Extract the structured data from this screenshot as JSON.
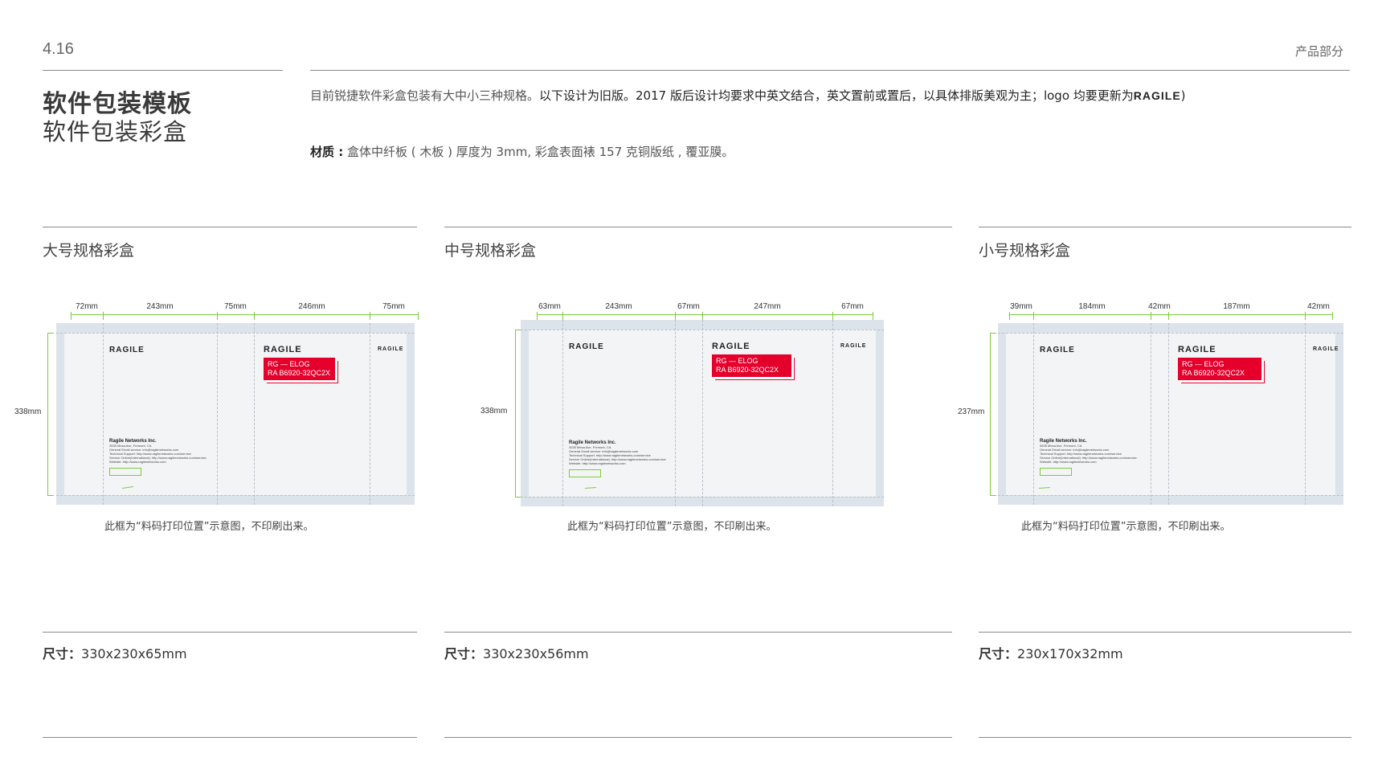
{
  "header": {
    "page_number": "4.16",
    "section": "产品部分",
    "title_main": "软件包装模板",
    "title_sub": "软件包装彩盒"
  },
  "intro": {
    "part1": "目前锐捷软件彩盒包装有大中小三种规格。",
    "part2": "以下设计为旧版。2017 版后设计均要求中英文结合，英文置前或置后，以具体排版美观为主；logo 均要更新为",
    "logo_text": "RAGILE",
    "part3": ")"
  },
  "material": {
    "label": "材质 :",
    "text": " 盒体中纤板 ( 木板 ) 厚度为 3mm, 彩盒表面裱 157 克铜版纸 , 覆亚膜。"
  },
  "boxes": [
    {
      "title": "大号规格彩盒",
      "dims": [
        "72mm",
        "243mm",
        "75mm",
        "246mm",
        "75mm"
      ],
      "height": "338mm",
      "brand": "RAGILE",
      "label_line1": "RG — ELOG",
      "label_line2": "RA B6920-32QC2X",
      "company": "Ragile Networks Inc.",
      "addr_lines": [
        "3535 Mesa Ave, Fremont, CA",
        "General Email service: info@ragilenetworks.com",
        "Technical Support: http://www.ragilenetworks.com/service",
        "Service Online(International): http://www.ragilenetworks.com/service",
        "Website: http://www.ragilenetworks.com"
      ],
      "note": "此框为“料码打印位置”示意图，不印刷出来。",
      "size_label": "尺寸：",
      "size_value": "330x230x65mm"
    },
    {
      "title": "中号规格彩盒",
      "dims": [
        "63mm",
        "243mm",
        "67mm",
        "247mm",
        "67mm"
      ],
      "height": "338mm",
      "brand": "RAGILE",
      "label_line1": "RG — ELOG",
      "label_line2": "RA B6920-32QC2X",
      "company": "Ragile Networks Inc.",
      "addr_lines": [
        "3535 Mesa Ave, Fremont, CA",
        "General Email service: info@ragilenetworks.com",
        "Technical Support: http://www.ragilenetworks.com/service",
        "Service Online(International): http://www.ragilenetworks.com/service",
        "Website: http://www.ragilenetworks.com"
      ],
      "note": "此框为“料码打印位置”示意图，不印刷出来。",
      "size_label": "尺寸：",
      "size_value": "330x230x56mm"
    },
    {
      "title": "小号规格彩盒",
      "dims": [
        "39mm",
        "184mm",
        "42mm",
        "187mm",
        "42mm"
      ],
      "height": "237mm",
      "brand": "RAGILE",
      "label_line1": "RG — ELOG",
      "label_line2": "RA B6920-32QC2X",
      "company": "Ragile Networks Inc.",
      "addr_lines": [
        "3535 Mesa Ave, Fremont, CA",
        "General Email service: info@ragilenetworks.com",
        "Technical Support: http://www.ragilenetworks.com/service",
        "Service Online(International): http://www.ragilenetworks.com/service",
        "Website: http://www.ragilenetworks.com"
      ],
      "note": "此框为“料码打印位置”示意图，不印刷出来。",
      "size_label": "尺寸：",
      "size_value": "230x170x32mm"
    }
  ],
  "colors": {
    "accent_red": "#e4002b",
    "dim_green": "#7ccb3d"
  }
}
